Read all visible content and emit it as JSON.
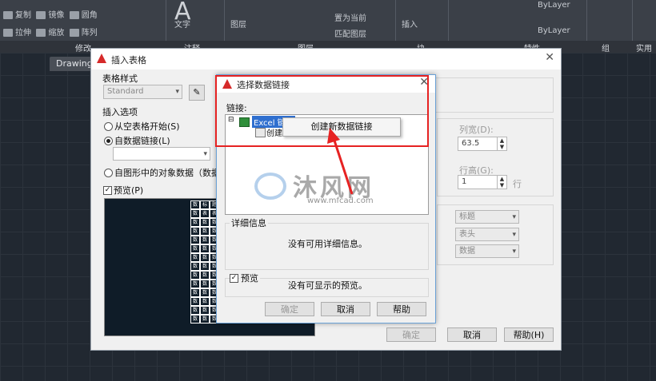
{
  "ribbon": {
    "row1": [
      "复制",
      "镜像",
      "圆角",
      "文字",
      "图层",
      "置为当前",
      "插入",
      "ByLayer"
    ],
    "row2": [
      "拉伸",
      "缩放",
      "阵列",
      "匹配图层",
      "ByLayer"
    ],
    "panels": [
      "修改",
      "注释",
      "图层",
      "块",
      "特性",
      "组",
      "实用"
    ],
    "bylayer_1": "ByLayer",
    "bylayer_2": "ByLayer"
  },
  "document_tab": "Drawing",
  "insert_dialog": {
    "title": "插入表格",
    "table_style_label": "表格样式",
    "table_style_value": "Standard",
    "insert_options_label": "插入选项",
    "opt_empty": "从空表格开始(S)",
    "opt_datalink": "自数据链接(L)",
    "opt_object": "自图形中的对象数据（数据提",
    "preview_label": "预览(P)",
    "col_width_label": "列宽(D):",
    "col_width_value": "63.5",
    "row_height_label": "行高(G):",
    "row_height_value": "1",
    "row_unit": "行",
    "cell_style_rows": [
      "标题",
      "表头",
      "数据"
    ],
    "ok": "确定",
    "cancel": "取消",
    "help": "帮助(H)"
  },
  "link_dialog": {
    "title": "选择数据链接",
    "links_label": "链接:",
    "tree_excel": "Excel 链接",
    "tree_create": "创建",
    "context_menu_item": "创建新数据链接",
    "detail_label": "详细信息",
    "detail_text": "没有可用详细信息。",
    "preview_label": "预览",
    "preview_text": "没有可显示的预览。",
    "ok": "确定",
    "cancel": "取消",
    "help": "帮助"
  },
  "watermark": {
    "text": "沐风网",
    "url": "www.mfcad.com"
  },
  "colors": {
    "highlight": "#e62222",
    "autocad_red": "#d62a2a",
    "canvas": "#212831"
  }
}
